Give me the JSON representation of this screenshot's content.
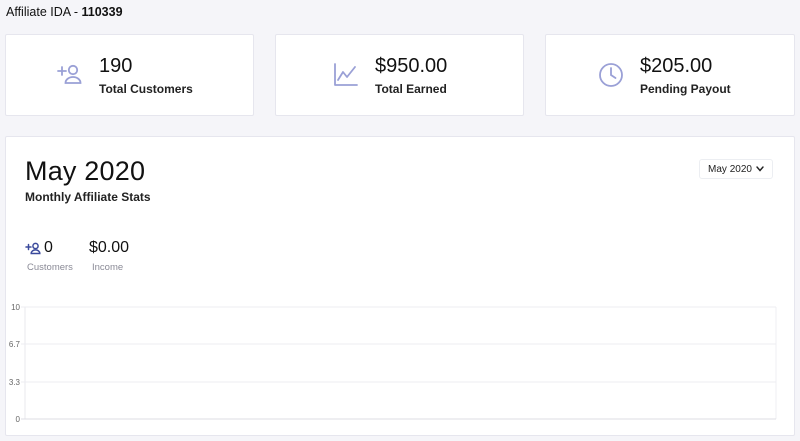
{
  "header": {
    "prefix": "Affiliate IDA - ",
    "affiliate_id": "110339"
  },
  "stats": [
    {
      "value": "190",
      "label": "Total Customers",
      "icon": "add-user-icon"
    },
    {
      "value": "$950.00",
      "label": "Total Earned",
      "icon": "line-chart-icon"
    },
    {
      "value": "$205.00",
      "label": "Pending Payout",
      "icon": "clock-icon"
    }
  ],
  "monthly": {
    "title": "May 2020",
    "subtitle": "Monthly Affiliate Stats",
    "selected_month": "May 2020",
    "customers": {
      "value": "0",
      "label": "Customers"
    },
    "income": {
      "value": "$0.00",
      "label": "Income"
    }
  },
  "colors": {
    "accent": "#9aa0d6",
    "icon_dark": "#3b4a9c"
  },
  "chart_data": {
    "type": "line",
    "y_ticks": [
      "10",
      "6.7",
      "3.3",
      "0"
    ],
    "ylim": [
      0,
      10
    ],
    "grid": true,
    "series": []
  }
}
